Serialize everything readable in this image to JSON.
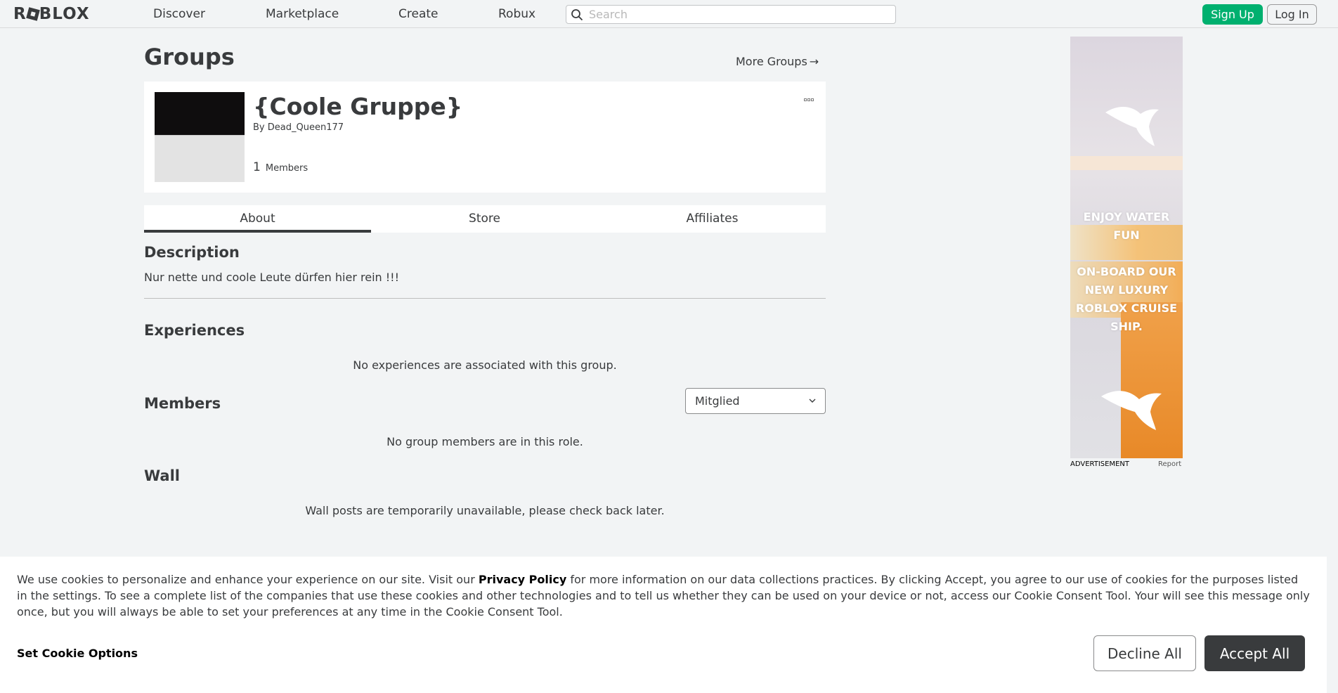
{
  "nav": {
    "logo": "ROBLOX",
    "links": [
      "Discover",
      "Marketplace",
      "Create",
      "Robux"
    ],
    "search_placeholder": "Search",
    "search_value": "",
    "signup_label": "Sign Up",
    "login_label": "Log In"
  },
  "page": {
    "title": "Groups",
    "more_groups_label": "More Groups"
  },
  "group": {
    "name": "{Coole Gruppe}",
    "by_label": "By",
    "owner": "Dead_Queen177",
    "member_count": "1",
    "members_label": "Members"
  },
  "tabs": [
    {
      "label": "About",
      "active": true
    },
    {
      "label": "Store",
      "active": false
    },
    {
      "label": "Affiliates",
      "active": false
    }
  ],
  "about": {
    "description_title": "Description",
    "description_text": "Nur nette und coole Leute dürfen hier rein !!!",
    "experiences_title": "Experiences",
    "experiences_empty": "No experiences are associated with this group.",
    "members_title": "Members",
    "role_selected": "Mitglied",
    "members_empty": "No group members are in this role.",
    "wall_title": "Wall",
    "wall_empty": "Wall posts are temporarily unavailable, please check back later."
  },
  "ad": {
    "text_1": "ENJOY WATER FUN",
    "text_2": "ON-BOARD OUR NEW LUXURY ROBLOX CRUISE SHIP.",
    "label": "ADVERTISEMENT",
    "report": "Report"
  },
  "cookie": {
    "text_before": "We use cookies to personalize and enhance your experience on our site. Visit our ",
    "privacy_link": "Privacy Policy",
    "text_after": " for more information on our data collections practices. By clicking Accept, you agree to our use of cookies for the purposes listed in the settings. To see a complete list of the companies that use these cookies and other technologies and to tell us whether they can be used on your device or not, access our Cookie Consent Tool. Your will see this message only once, but you will always be able to set your preferences at any time in the Cookie Consent Tool.",
    "options_label": "Set Cookie Options",
    "decline_label": "Decline All",
    "accept_label": "Accept All"
  },
  "colors": {
    "page_bg": "#f2f4f5",
    "primary_green": "#00b06f",
    "text": "#393b3d",
    "accept_bg": "#393b3d"
  }
}
